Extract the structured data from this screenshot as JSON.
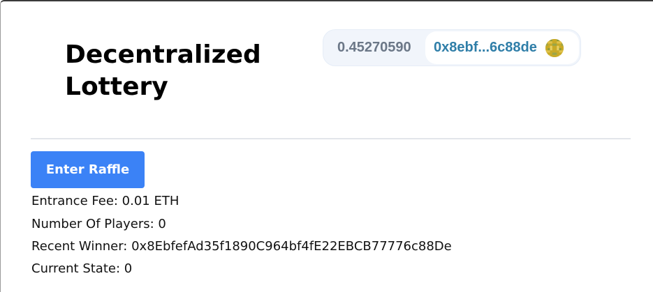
{
  "header": {
    "title": "Decentralized Lottery"
  },
  "wallet": {
    "balance": "0.45270590",
    "address": "0x8ebf...6c88de",
    "avatar_icon": "identicon-avatar",
    "address_color": "#2f7ea8"
  },
  "main": {
    "enter_button_label": "Enter Raffle",
    "button_color": "#3b82f6",
    "entrance_fee": "Entrance Fee: 0.01 ETH",
    "number_of_players": "Number Of Players: 0",
    "recent_winner": "Recent Winner: 0x8EbfefAd35f1890C964bf4fE22EBCB77776c88De",
    "current_state": "Current State: 0"
  }
}
